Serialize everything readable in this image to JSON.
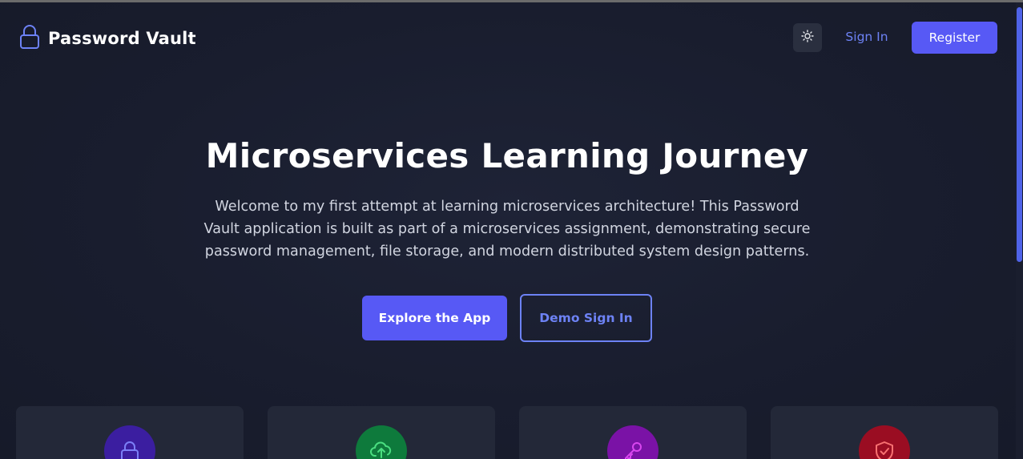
{
  "header": {
    "brand_title": "Password Vault",
    "brand_icon": "lock-icon",
    "theme_toggle_icon": "sun-icon",
    "signin_label": "Sign In",
    "register_label": "Register"
  },
  "hero": {
    "title": "Microservices Learning Journey",
    "description": "Welcome to my first attempt at learning microservices architecture! This Password Vault application is built as part of a microservices assignment, demonstrating secure password management, file storage, and modern distributed system design patterns.",
    "primary_button": "Explore the App",
    "secondary_button": "Demo Sign In"
  },
  "features": [
    {
      "icon": "lock-icon",
      "color": "#3b1ea0"
    },
    {
      "icon": "cloud-upload-icon",
      "color": "#0e7a3c"
    },
    {
      "icon": "key-icon",
      "color": "#7a12a6"
    },
    {
      "icon": "shield-check-icon",
      "color": "#9a0d22"
    }
  ],
  "colors": {
    "accent": "#5759f5",
    "link": "#6d82f5",
    "background": "#181c2d",
    "card": "#232838"
  }
}
